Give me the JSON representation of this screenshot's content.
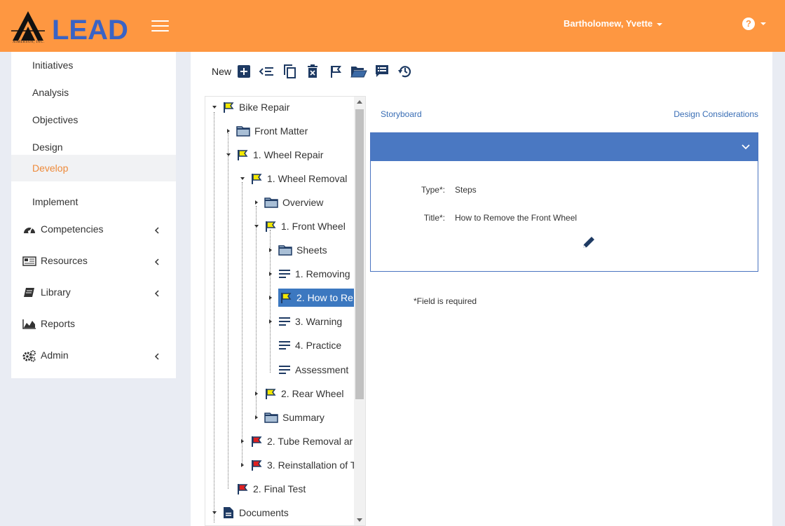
{
  "header": {
    "logo_text": "LEAD",
    "logo_sub": "AIMERSON, INC.",
    "user_name": "Bartholomew, Yvette",
    "help_glyph": "?",
    "accent": "#fe9741"
  },
  "sidebar": {
    "sub_items": [
      {
        "label": "Initiatives"
      },
      {
        "label": "Analysis"
      },
      {
        "label": "Objectives"
      },
      {
        "label": "Design"
      },
      {
        "label": "Develop",
        "active": true
      },
      {
        "label": "Implement"
      }
    ],
    "nav_items": [
      {
        "label": "Competencies",
        "icon": "dashboard-icon",
        "has_chevron": true
      },
      {
        "label": "Resources",
        "icon": "newspaper-icon",
        "has_chevron": true
      },
      {
        "label": "Library",
        "icon": "book-icon",
        "has_chevron": true
      },
      {
        "label": "Reports",
        "icon": "area-chart-icon",
        "has_chevron": false
      },
      {
        "label": "Admin",
        "icon": "cogs-icon",
        "has_chevron": true
      }
    ]
  },
  "toolbar": {
    "new_label": "New",
    "buttons": [
      "add-icon",
      "list-indent-icon",
      "copy-icon",
      "delete-icon",
      "flag-icon",
      "folder-open-icon",
      "comment-list-icon",
      "history-icon"
    ]
  },
  "tree": {
    "nodes": [
      {
        "label": "Bike Repair",
        "icon": "flag-yellow",
        "expanded": true
      },
      {
        "label": "Front Matter",
        "icon": "folder",
        "expanded": false
      },
      {
        "label": "1. Wheel Repair",
        "icon": "flag-yellow",
        "expanded": true
      },
      {
        "label": "1. Wheel Removal",
        "icon": "flag-yellow",
        "expanded": true
      },
      {
        "label": "Overview",
        "icon": "folder",
        "expanded": false
      },
      {
        "label": "1. Front Wheel",
        "icon": "flag-yellow",
        "expanded": true
      },
      {
        "label": "Sheets",
        "icon": "folder",
        "expanded": false
      },
      {
        "label": "1. Removing",
        "icon": "lines",
        "expanded": false
      },
      {
        "label": "2. How to Re",
        "icon": "flag-yellow",
        "expanded": false,
        "selected": true
      },
      {
        "label": "3. Warning",
        "icon": "lines",
        "expanded": false
      },
      {
        "label": "4. Practice",
        "icon": "lines",
        "expanded": null
      },
      {
        "label": "Assessment",
        "icon": "lines",
        "expanded": null
      },
      {
        "label": "2. Rear Wheel",
        "icon": "flag-yellow",
        "expanded": false
      },
      {
        "label": "Summary",
        "icon": "folder",
        "expanded": false
      },
      {
        "label": "2. Tube Removal ar",
        "icon": "flag-red",
        "expanded": false
      },
      {
        "label": "3. Reinstallation of T",
        "icon": "flag-red",
        "expanded": false
      },
      {
        "label": "2. Final Test",
        "icon": "flag-red",
        "expanded": null
      },
      {
        "label": "Documents",
        "icon": "document",
        "expanded": true
      }
    ]
  },
  "content": {
    "storyboard_link": "Storyboard",
    "design_link": "Design Considerations",
    "type_label": "Type*:",
    "type_value": "Steps",
    "title_label": "Title*:",
    "title_value": "How to Remove the Front Wheel",
    "required_note": "*Field is required",
    "panel_color": "#4a78c2"
  }
}
